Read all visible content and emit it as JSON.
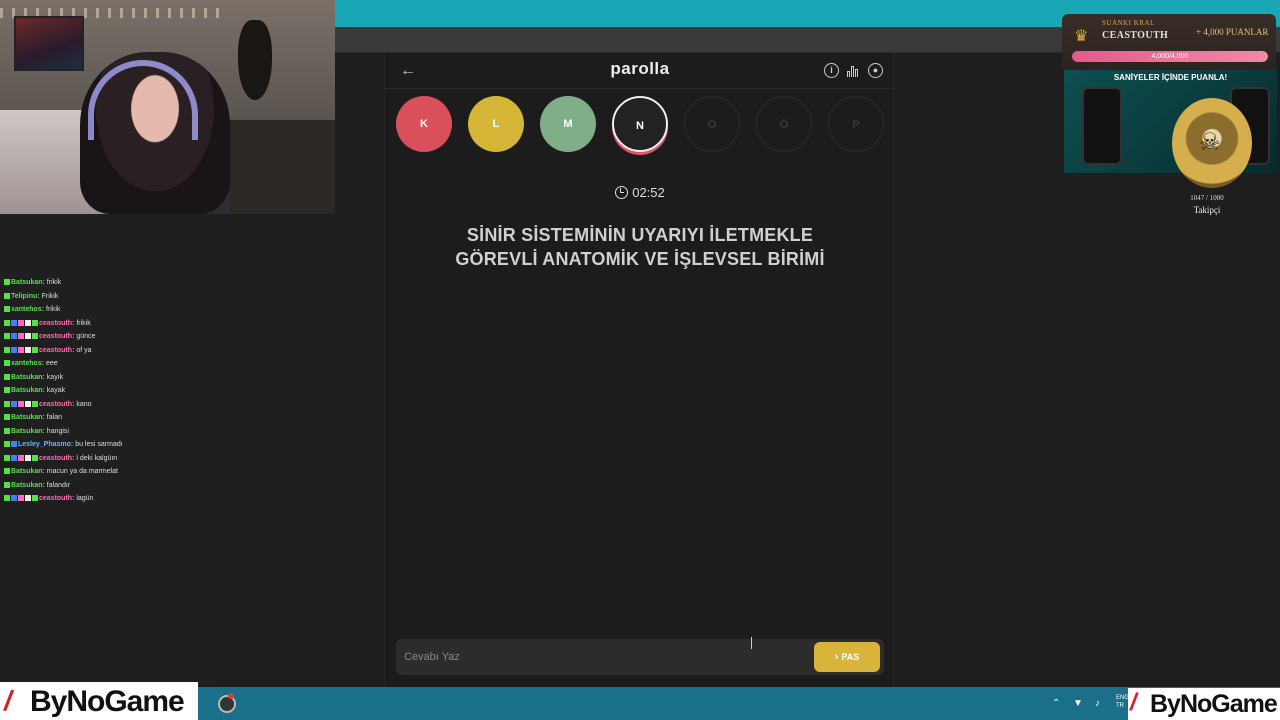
{
  "game": {
    "logo": "parolla",
    "timer": "02:52",
    "question": "SİNİR SİSTEMİNİN UYARIYI İLETMEKLE GÖREVLİ ANATOMİK VE İŞLEVSEL BİRİMİ",
    "answer_placeholder": "Cevabı Yaz",
    "pass_label": "PAS",
    "letters": [
      {
        "letter": "K",
        "state": "wrong",
        "color": "#d9505c"
      },
      {
        "letter": "L",
        "state": "passed",
        "color": "#d5b637"
      },
      {
        "letter": "M",
        "state": "correct",
        "color": "#7fae88"
      },
      {
        "letter": "N",
        "state": "current",
        "color": "#222222"
      },
      {
        "letter": "O",
        "state": "pending",
        "color": "#1c1c1c"
      },
      {
        "letter": "Ö",
        "state": "pending",
        "color": "#1c1c1c"
      },
      {
        "letter": "P",
        "state": "pending",
        "color": "#1c1c1c"
      }
    ]
  },
  "king": {
    "label": "SUANKI KRAL",
    "name": "CEASTOUTH",
    "points": "+ 4,000 PUANLAR",
    "progress_text": "4,000/4,000",
    "progress": 1.0
  },
  "ad": {
    "title": "SANİYELER İÇİNDE PUANLA!"
  },
  "followers": {
    "count": "1047 / 1000",
    "label": "Takipçi"
  },
  "chat": [
    {
      "user": "Batsukan",
      "msg": "frikik",
      "color": "#56e04a",
      "badges": [
        "green"
      ]
    },
    {
      "user": "Telipinu",
      "msg": "Frikik",
      "color": "#56e04a",
      "badges": [
        "green"
      ]
    },
    {
      "user": "xantehos",
      "msg": "frikik",
      "color": "#56e04a",
      "badges": [
        "green"
      ]
    },
    {
      "user": "ceastouth",
      "msg": "frikik",
      "color": "#ff6bb5",
      "badges": [
        "green",
        "blue",
        "pink",
        "white",
        "green"
      ]
    },
    {
      "user": "ceastouth",
      "msg": "günce",
      "color": "#ff6bb5",
      "badges": [
        "green",
        "blue",
        "pink",
        "white",
        "green"
      ]
    },
    {
      "user": "ceastouth",
      "msg": "of ya",
      "color": "#ff6bb5",
      "badges": [
        "green",
        "blue",
        "pink",
        "white",
        "green"
      ]
    },
    {
      "user": "xantehos",
      "msg": "eee",
      "color": "#56e04a",
      "badges": [
        "green"
      ]
    },
    {
      "user": "Batsukan",
      "msg": "kayık",
      "color": "#56e04a",
      "badges": [
        "green"
      ]
    },
    {
      "user": "Batsukan",
      "msg": "kayak",
      "color": "#56e04a",
      "badges": [
        "green"
      ]
    },
    {
      "user": "ceastouth",
      "msg": "kano",
      "color": "#ff6bb5",
      "badges": [
        "green",
        "blue",
        "pink",
        "white",
        "green"
      ]
    },
    {
      "user": "Batsukan",
      "msg": "falan",
      "color": "#56e04a",
      "badges": [
        "green"
      ]
    },
    {
      "user": "Batsukan",
      "msg": "hangisi",
      "color": "#56e04a",
      "badges": [
        "green"
      ]
    },
    {
      "user": "Lesley_Phasmo",
      "msg": "bu lesi sarmadı",
      "color": "#6ab6ff",
      "badges": [
        "green",
        "blue"
      ]
    },
    {
      "user": "ceastouth",
      "msg": "l deki kalgüın",
      "color": "#ff6bb5",
      "badges": [
        "green",
        "blue",
        "pink",
        "white",
        "green"
      ]
    },
    {
      "user": "Batsukan",
      "msg": "macun ya da marmelat",
      "color": "#56e04a",
      "badges": [
        "green"
      ]
    },
    {
      "user": "Batsukan",
      "msg": "falandır",
      "color": "#56e04a",
      "badges": [
        "green"
      ]
    },
    {
      "user": "ceastouth",
      "msg": "lagün",
      "color": "#ff6bb5",
      "badges": [
        "green",
        "blue",
        "pink",
        "white",
        "green"
      ]
    }
  ],
  "watermark": {
    "text": "ByNoGame"
  },
  "taskbar": {
    "lang_1": "ENG",
    "lang_2": "TR"
  }
}
